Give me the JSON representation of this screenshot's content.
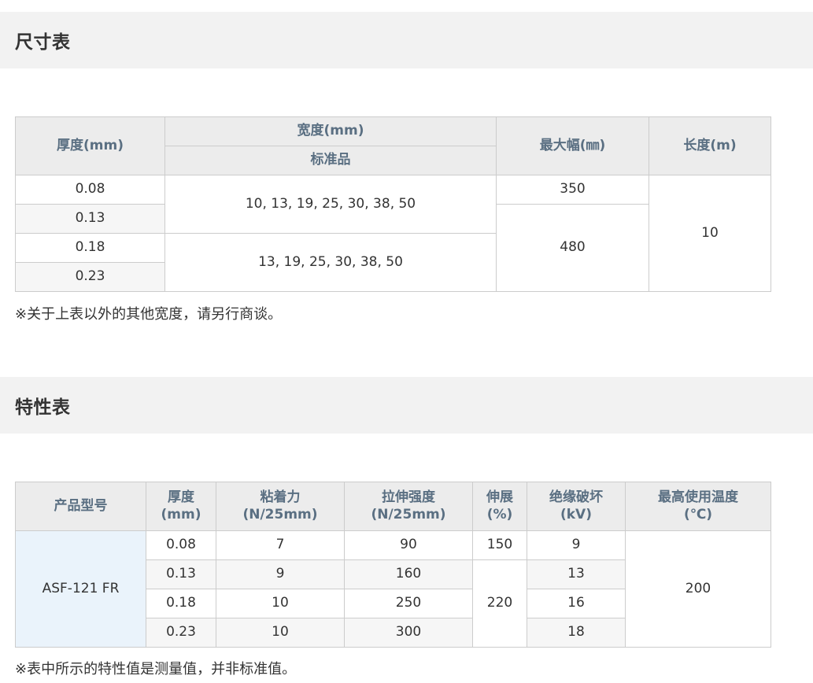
{
  "size_section": {
    "title": "尺寸表",
    "headers": {
      "thickness": "厚度(mm)",
      "width": "宽度(mm)",
      "standard": "标准品",
      "max_width": "最大幅(㎜)",
      "length": "长度(m)"
    },
    "rows": [
      {
        "thickness": "0.08"
      },
      {
        "thickness": "0.13"
      },
      {
        "thickness": "0.18"
      },
      {
        "thickness": "0.23"
      }
    ],
    "widths_a": "10, 13, 19, 25, 30, 38, 50",
    "widths_b": "13, 19, 25, 30, 38, 50",
    "max_a": "350",
    "max_b": "480",
    "length": "10",
    "note": "※关于上表以外的其他宽度，请另行商谈。"
  },
  "props_section": {
    "title": "特性表",
    "headers": {
      "model": "产品型号",
      "thickness_1": "厚度",
      "thickness_2": "(mm)",
      "adhesion_1": "粘着力",
      "adhesion_2": "(N/25mm)",
      "tensile_1": "拉伸强度",
      "tensile_2": "(N/25mm)",
      "elongation_1": "伸展",
      "elongation_2": "(%)",
      "breakdown_1": "绝缘破坏",
      "breakdown_2": "(kV)",
      "max_temp_1": "最高使用温度",
      "max_temp_2": "(℃)"
    },
    "model": "ASF-121 FR",
    "rows": [
      {
        "thickness": "0.08",
        "adhesion": "7",
        "tensile": "90",
        "breakdown": "9"
      },
      {
        "thickness": "0.13",
        "adhesion": "9",
        "tensile": "160",
        "breakdown": "13"
      },
      {
        "thickness": "0.18",
        "adhesion": "10",
        "tensile": "250",
        "breakdown": "16"
      },
      {
        "thickness": "0.23",
        "adhesion": "10",
        "tensile": "300",
        "breakdown": "18"
      }
    ],
    "elongation_a": "150",
    "elongation_b": "220",
    "max_temp": "200",
    "note": "※表中所示的特性值是测量值，并非标准值。"
  }
}
